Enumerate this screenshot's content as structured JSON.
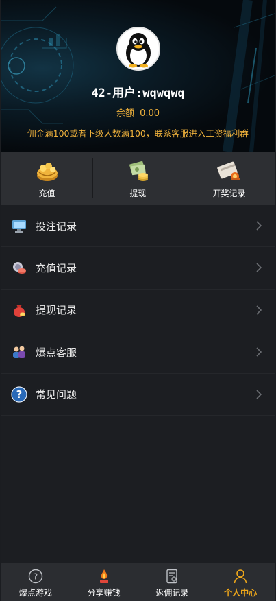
{
  "profile": {
    "username": "42-用户:wqwqwq",
    "balance_label": "余额",
    "balance_value": "0.00",
    "notice": "佣金满100或者下级人数满100，联系客服进入工资福利群"
  },
  "actions": [
    {
      "label": "充值",
      "icon": "recharge-icon"
    },
    {
      "label": "提现",
      "icon": "withdraw-icon"
    },
    {
      "label": "开奖记录",
      "icon": "lottery-record-icon"
    }
  ],
  "menu": [
    {
      "label": "投注记录",
      "icon": "monitor-icon"
    },
    {
      "label": "充值记录",
      "icon": "coins-icon"
    },
    {
      "label": "提现记录",
      "icon": "money-bag-icon"
    },
    {
      "label": "爆点客服",
      "icon": "service-icon"
    },
    {
      "label": "常见问题",
      "icon": "help-icon"
    }
  ],
  "tabs": [
    {
      "label": "爆点游戏",
      "icon": "game-icon",
      "active": false
    },
    {
      "label": "分享赚钱",
      "icon": "share-icon",
      "active": false
    },
    {
      "label": "返佣记录",
      "icon": "commission-icon",
      "active": false
    },
    {
      "label": "个人中心",
      "icon": "user-icon",
      "active": true
    }
  ],
  "colors": {
    "accent": "#f0a81a",
    "notice": "#f0b23c",
    "background": "#1c1e22",
    "panel": "#2d2f33"
  }
}
